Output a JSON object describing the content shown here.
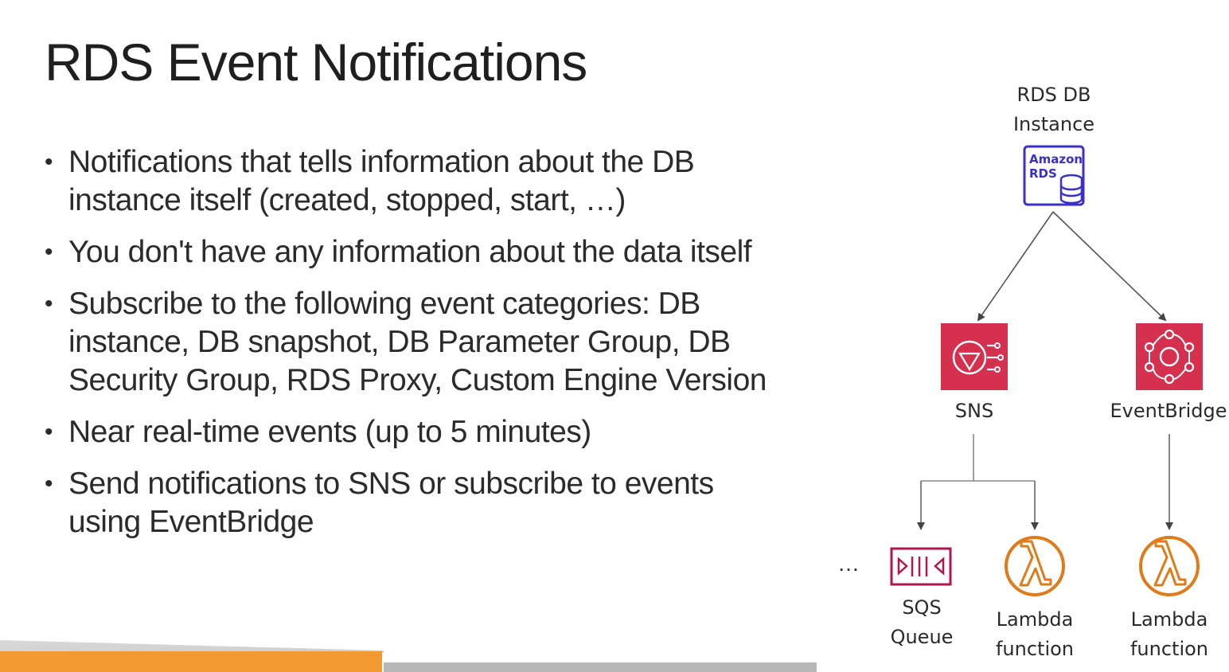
{
  "title": "RDS Event Notifications",
  "bullets": [
    {
      "lines": [
        "Notifications that tells information about the DB",
        "instance itself (created, stopped, start, …)"
      ]
    },
    {
      "lines": [
        "You don't have any information about the data itself"
      ]
    },
    {
      "lines": [
        "Subscribe to the following event categories: DB",
        "instance, DB snapshot, DB Parameter Group, DB",
        "Security Group, RDS Proxy, Custom Engine Version"
      ]
    },
    {
      "lines": [
        "Near real-time events (up to 5 minutes)"
      ]
    },
    {
      "lines": [
        "Send notifications to SNS or subscribe to events",
        "using EventBridge"
      ]
    }
  ],
  "diagram": {
    "rds": {
      "label_line1": "RDS DB",
      "label_line2": "Instance",
      "icon_text_1": "Amazon",
      "icon_text_2": "RDS",
      "icon": "amazon-rds-icon",
      "color": "#3b2fc9"
    },
    "sns": {
      "label": "SNS",
      "icon": "sns-icon",
      "color": "#d6304f"
    },
    "eventbridge": {
      "label": "EventBridge",
      "icon": "eventbridge-icon",
      "color": "#d6304f"
    },
    "sqs": {
      "label_line1": "SQS",
      "label_line2": "Queue",
      "icon": "sqs-queue-icon",
      "color": "#b0174d"
    },
    "lambda_sns": {
      "label_line1": "Lambda",
      "label_line2": "function",
      "icon": "lambda-icon",
      "color": "#e07b1a"
    },
    "lambda_eb": {
      "label_line1": "Lambda",
      "label_line2": "function",
      "icon": "lambda-icon",
      "color": "#e07b1a"
    },
    "ellipsis": "…"
  },
  "colors": {
    "footer_accent": "#f29a30"
  }
}
